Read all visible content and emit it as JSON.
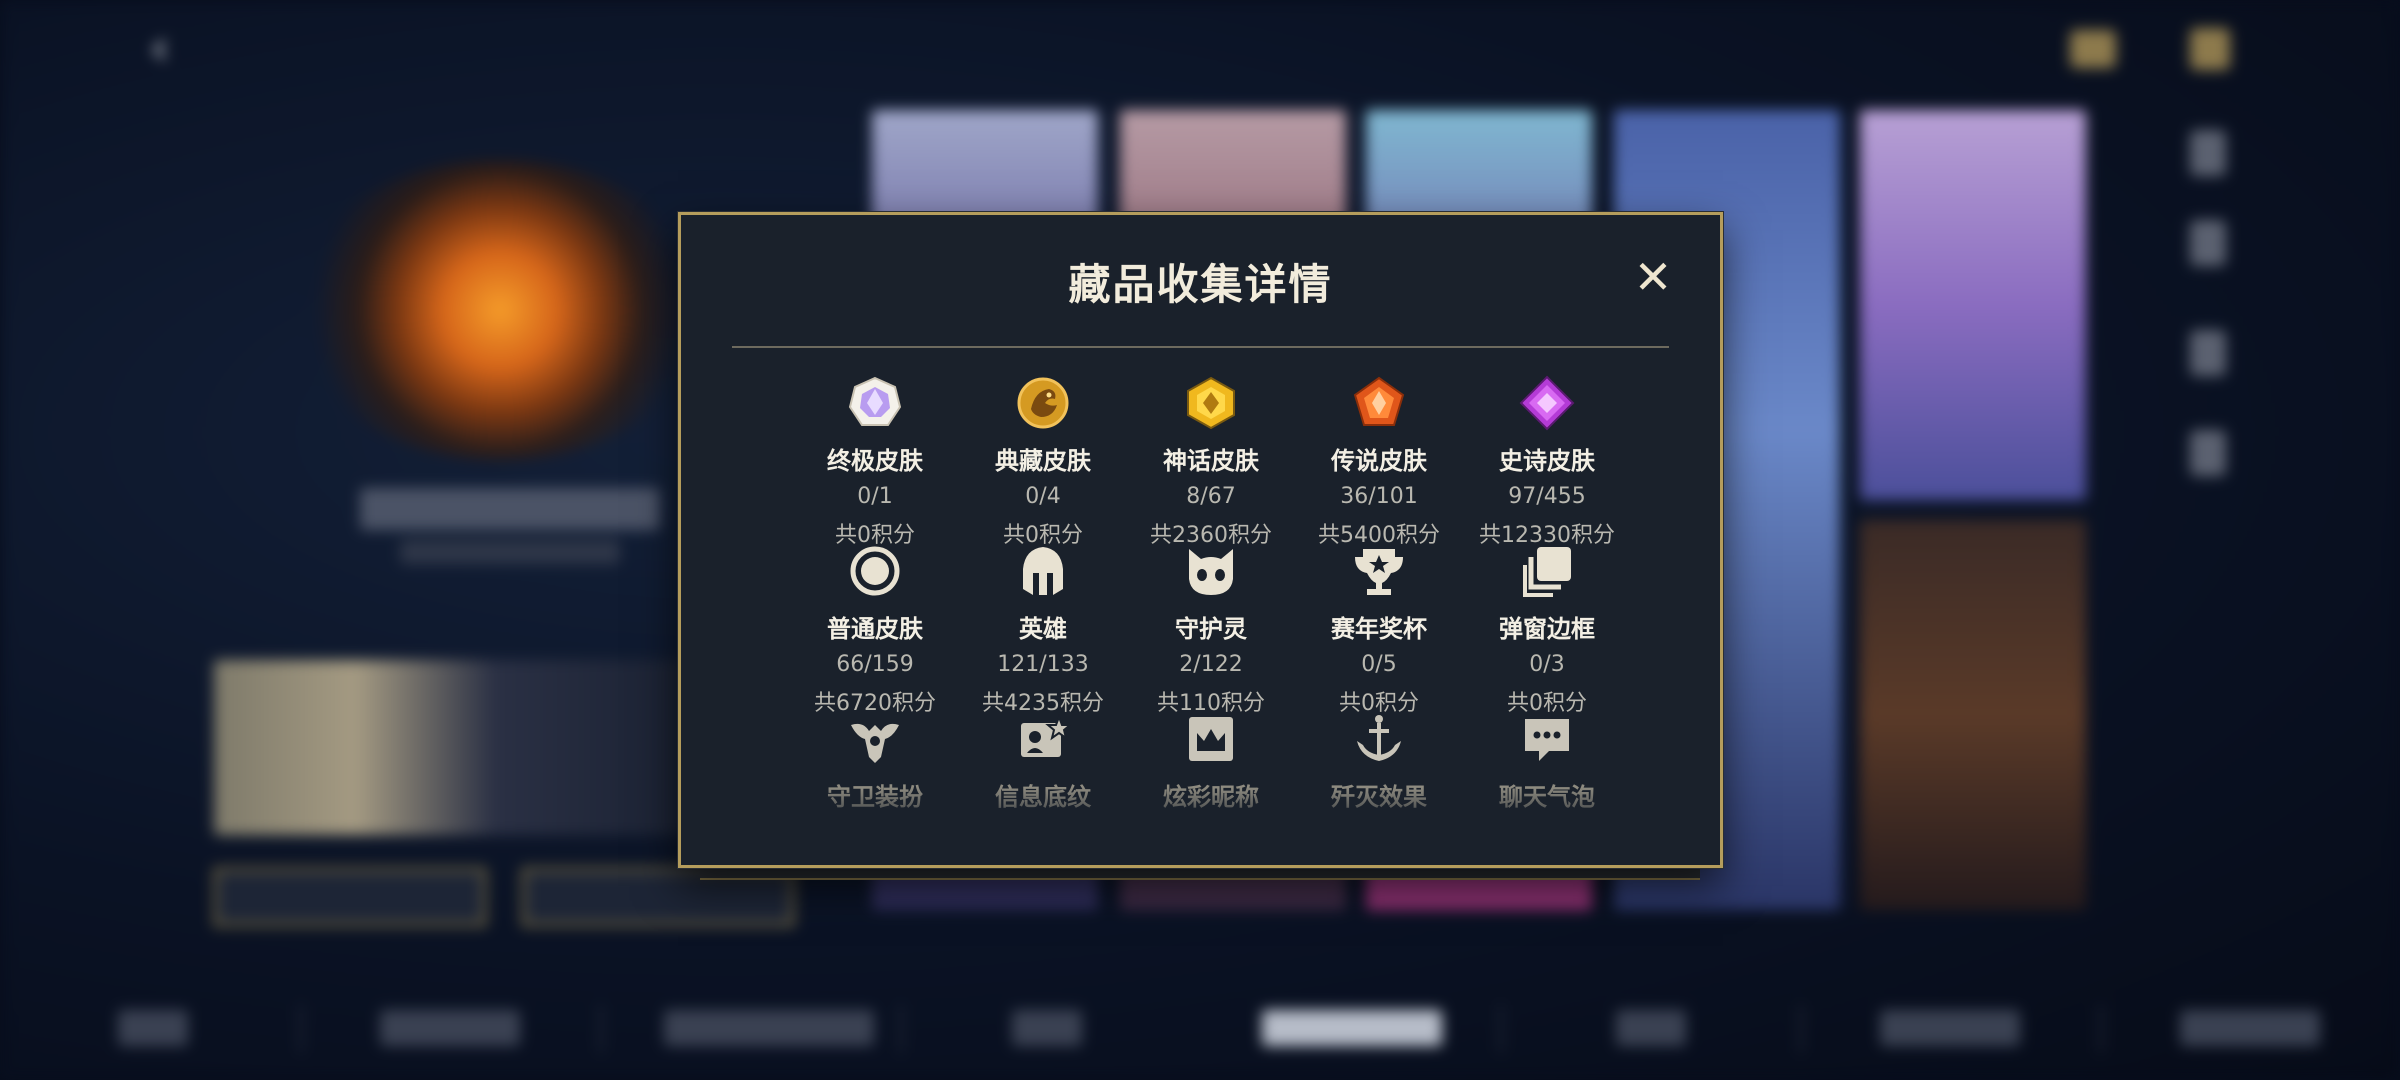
{
  "modal": {
    "title": "藏品收集详情",
    "close_label": "✕"
  },
  "items": [
    {
      "name": "终极皮肤",
      "count": "0/1",
      "points": "共0积分",
      "icon": "ultimate-skin-gem-icon"
    },
    {
      "name": "典藏皮肤",
      "count": "0/4",
      "points": "共0积分",
      "icon": "collection-skin-dragon-icon"
    },
    {
      "name": "神话皮肤",
      "count": "8/67",
      "points": "共2360积分",
      "icon": "mythic-skin-gem-icon"
    },
    {
      "name": "传说皮肤",
      "count": "36/101",
      "points": "共5400积分",
      "icon": "legendary-skin-gem-icon"
    },
    {
      "name": "史诗皮肤",
      "count": "97/455",
      "points": "共12330积分",
      "icon": "epic-skin-gem-icon"
    },
    {
      "name": "普通皮肤",
      "count": "66/159",
      "points": "共6720积分",
      "icon": "normal-skin-ring-icon"
    },
    {
      "name": "英雄",
      "count": "121/133",
      "points": "共4235积分",
      "icon": "hero-helmet-icon"
    },
    {
      "name": "守护灵",
      "count": "2/122",
      "points": "共110积分",
      "icon": "guardian-spirit-icon"
    },
    {
      "name": "赛年奖杯",
      "count": "0/5",
      "points": "共0积分",
      "icon": "season-trophy-icon"
    },
    {
      "name": "弹窗边框",
      "count": "0/3",
      "points": "共0积分",
      "icon": "popup-frame-icon"
    },
    {
      "name": "守卫装扮",
      "icon": "guard-outfit-icon"
    },
    {
      "name": "信息底纹",
      "icon": "info-background-icon"
    },
    {
      "name": "炫彩昵称",
      "icon": "colorful-nickname-icon"
    },
    {
      "name": "歼灭效果",
      "icon": "annihilation-effect-icon"
    },
    {
      "name": "聊天气泡",
      "icon": "chat-bubble-icon"
    }
  ],
  "colors": {
    "modal_border": "#b59d5c",
    "modal_bg": "#1a212b",
    "title": "#f2ecdc",
    "muted_text": "#b9b8b0"
  }
}
